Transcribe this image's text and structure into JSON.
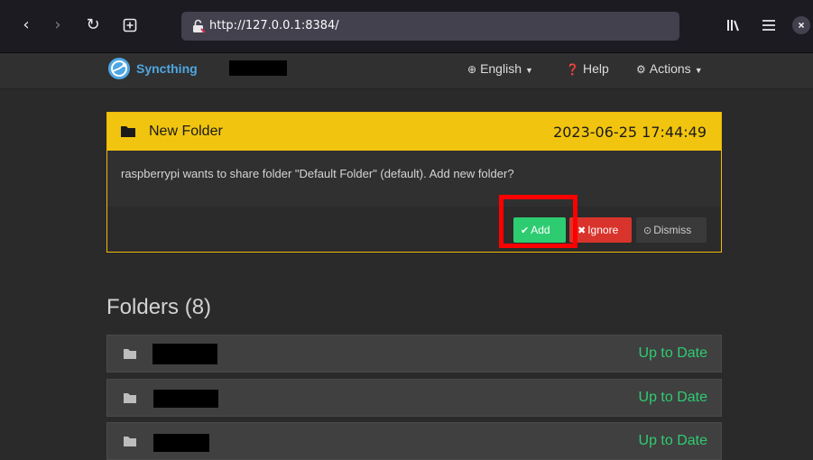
{
  "browser": {
    "back_icon": "chevron-left-icon",
    "forward_icon": "chevron-right-icon",
    "reload_icon": "reload-icon",
    "new_tab_icon": "plus-square-icon",
    "url": "http://127.0.0.1:8384/",
    "library_icon": "library-icon",
    "menu_icon": "hamburger-icon",
    "close_icon": "close-icon"
  },
  "navbar": {
    "brand": "Syncthing",
    "language": "English",
    "help": "Help",
    "actions": "Actions"
  },
  "notification": {
    "title": "New Folder",
    "date": "2023-06-25 17:44:49",
    "message": "raspberrypi wants to share folder \"Default Folder\" (default). Add new folder?",
    "add_label": "Add",
    "ignore_label": "Ignore",
    "dismiss_label": "Dismiss"
  },
  "folders": {
    "title": "Folders (8)",
    "items": [
      {
        "status": "Up to Date"
      },
      {
        "status": "Up to Date"
      },
      {
        "status": "Up to Date"
      }
    ]
  },
  "colors": {
    "accent": "#f1c40f",
    "success": "#2ecc71",
    "danger": "#d9342b",
    "highlight": "#ff0000"
  }
}
